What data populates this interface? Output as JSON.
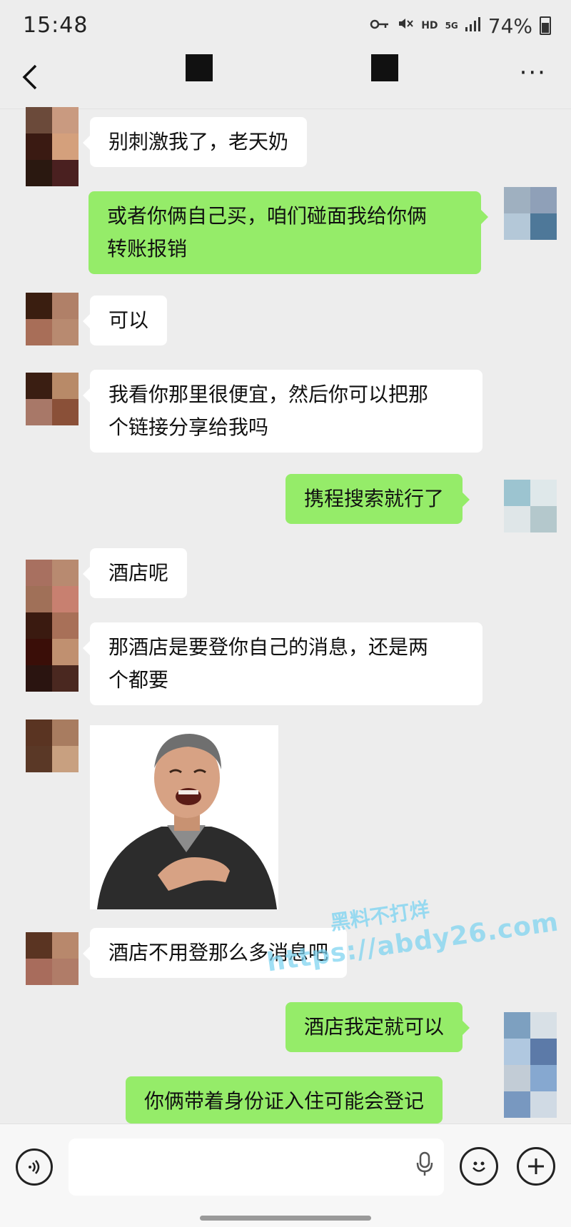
{
  "status_bar": {
    "time": "15:48",
    "icons": [
      "key-icon",
      "mute-icon",
      "hd-icon",
      "5g-icon",
      "signal-icon"
    ],
    "hd": "HD",
    "network": "5G",
    "battery": "74%"
  },
  "header": {
    "back_icon": "chevron-left-icon",
    "more_icon": "more-icon",
    "more_glyph": "···"
  },
  "messages": [
    {
      "side": "in",
      "text": "别刺激我了，老天奶"
    },
    {
      "side": "out",
      "line1": "或者你俩自己买，咱们碰面我给你俩",
      "line2": "转账报销"
    },
    {
      "side": "in",
      "text": "可以"
    },
    {
      "side": "in",
      "line1": "我看你那里很便宜，然后你可以把那",
      "line2": "个链接分享给我吗"
    },
    {
      "side": "out",
      "text": "携程搜索就行了"
    },
    {
      "side": "in",
      "text": "酒店呢"
    },
    {
      "side": "in",
      "line1": "那酒店是要登你自己的消息，还是两",
      "line2": "个都要"
    },
    {
      "side": "in",
      "type": "sticker"
    },
    {
      "side": "in",
      "text": "酒店不用登那么多消息吧"
    },
    {
      "side": "out",
      "text": "酒店我定就可以"
    },
    {
      "side": "out",
      "text": "你俩带着身份证入住可能会登记"
    }
  ],
  "watermark": {
    "line1": "黑料不打烊",
    "line2": "https://abdy26.com"
  },
  "input_bar": {
    "voice_icon": "voice-icon",
    "mic_icon": "microphone-icon",
    "emoji_icon": "emoji-icon",
    "plus_icon": "plus-icon"
  },
  "colors": {
    "background": "#ededed",
    "outgoing_bubble": "#95ec69",
    "incoming_bubble": "#ffffff"
  }
}
